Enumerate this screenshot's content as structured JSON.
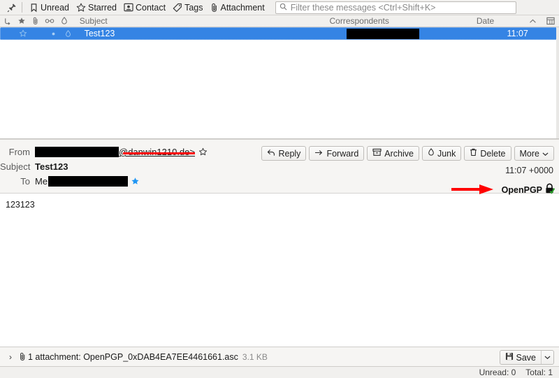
{
  "quick_filter": {
    "pin_icon": "pin-icon",
    "buttons": [
      {
        "label": "Unread",
        "icon": "unread-bookmark-icon"
      },
      {
        "label": "Starred",
        "icon": "star-icon"
      },
      {
        "label": "Contact",
        "icon": "contact-card-icon"
      },
      {
        "label": "Tags",
        "icon": "tag-icon"
      },
      {
        "label": "Attachment",
        "icon": "paperclip-icon"
      }
    ],
    "filter_placeholder": "Filter these messages <Ctrl+Shift+K>",
    "search_icon": "search-icon"
  },
  "thread_pane": {
    "columns": {
      "thread_icon": "thread-icon",
      "star_icon": "star-icon",
      "attachment_icon": "paperclip-icon",
      "read_icon": "read-dot-icon",
      "junk_icon": "junk-flame-icon",
      "subject": "Subject",
      "correspondents": "Correspondents",
      "date": "Date",
      "sort_icon": "sort-ascending-icon",
      "column_picker_icon": "column-picker-icon"
    },
    "rows": [
      {
        "subject": "Test123",
        "correspondent": "",
        "correspondent_redacted": true,
        "date": "11:07",
        "selected": true,
        "star_icon": "star-outline-icon",
        "read_icon": "read-dot-icon",
        "junk_icon": "junk-flame-icon"
      }
    ]
  },
  "message_header": {
    "from_label": "From",
    "from_redacted": true,
    "from_domain": "@danwin1210.de>",
    "from_star_icon": "star-outline-icon",
    "subject_label": "Subject",
    "subject_value": "Test123",
    "to_label": "To",
    "to_value": "Me",
    "to_redacted": true,
    "to_star_icon": "star-filled-icon",
    "date": "11:07 +0000",
    "actions": [
      {
        "label": "Reply",
        "icon": "reply-arrow-icon"
      },
      {
        "label": "Forward",
        "icon": "forward-arrow-icon"
      },
      {
        "label": "Archive",
        "icon": "archive-box-icon"
      },
      {
        "label": "Junk",
        "icon": "junk-flame-icon"
      },
      {
        "label": "Delete",
        "icon": "trash-icon"
      },
      {
        "label": "More",
        "icon": "chevron-down-icon"
      }
    ],
    "pgp_label": "OpenPGP",
    "pgp_icon": "lock-verified-icon",
    "annotation_icon": "red-arrow-icon"
  },
  "message_body": {
    "text": "123123"
  },
  "attachment_bar": {
    "twisty": "›",
    "clip_icon": "paperclip-icon",
    "text": "1 attachment: OpenPGP_0xDAB4EA7EE4461661.asc",
    "size": "3.1 KB",
    "save_label": "Save",
    "save_icon": "floppy-save-icon",
    "save_dropdown_icon": "chevron-down-icon"
  },
  "status_bar": {
    "unread": "Unread: 0",
    "total": "Total: 1"
  },
  "colors": {
    "selection_blue": "#3584e4",
    "annotation_red": "#ff0000",
    "star_blue": "#2196f3",
    "check_green": "#2aa12a",
    "toolbar_bg": "#f1f0ee"
  }
}
